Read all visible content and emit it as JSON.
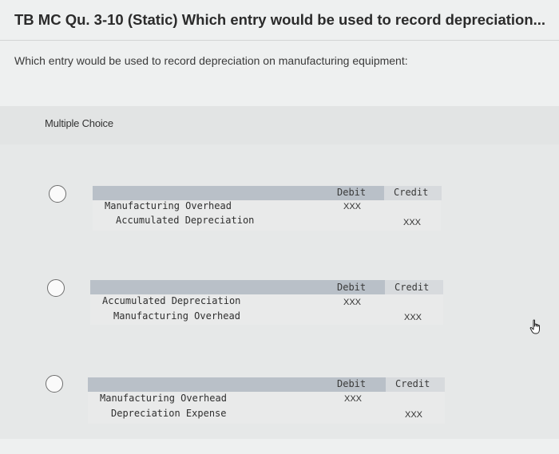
{
  "title": "TB MC Qu. 3-10 (Static) Which entry would be used to record depreciation...",
  "question": "Which entry would be used to record depreciation on manufacturing equipment:",
  "multiple_choice_label": "Multiple Choice",
  "choices": [
    {
      "headers": {
        "debit": "Debit",
        "credit": "Credit"
      },
      "debit_account": "Manufacturing Overhead",
      "credit_account": "Accumulated Depreciation",
      "debit_amount": "XXX",
      "credit_amount": "XXX"
    },
    {
      "headers": {
        "debit": "Debit",
        "credit": "Credit"
      },
      "debit_account": "Accumulated Depreciation",
      "credit_account": "Manufacturing Overhead",
      "debit_amount": "XXX",
      "credit_amount": "XXX"
    },
    {
      "headers": {
        "debit": "Debit",
        "credit": "Credit"
      },
      "debit_account": "Manufacturing Overhead",
      "credit_account": "Depreciation Expense",
      "debit_amount": "XXX",
      "credit_amount": "XXX"
    }
  ],
  "icons": {
    "cursor": "hand-pointer-icon"
  }
}
